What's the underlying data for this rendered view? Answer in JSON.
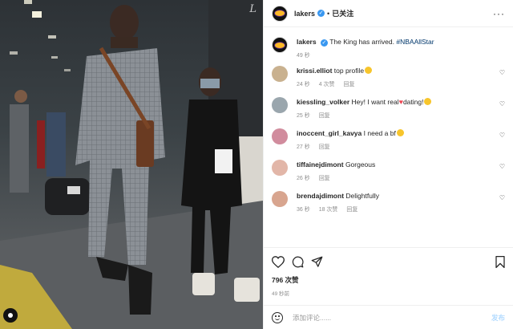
{
  "header": {
    "username": "lakers",
    "separator": "•",
    "follow_label": "已关注",
    "more_label": "···"
  },
  "caption": {
    "username": "lakers",
    "text": "The King has arrived.",
    "hashtag": "#NBAAllStar",
    "time": "49 秒"
  },
  "comments": [
    {
      "username": "krissi.elliot",
      "text": "top profile",
      "emoji": "smiley",
      "time": "24 秒",
      "likes": "4 次赞",
      "reply": "回复",
      "avatar_color": "#c9b18f"
    },
    {
      "username": "kiessling_volker",
      "text": "Hey! I want real",
      "text2": "dating!",
      "emoji": "heart+smiley",
      "time": "25 秒",
      "reply": "回复",
      "avatar_color": "#9aa6ad"
    },
    {
      "username": "inoccent_girl_kavya",
      "text": "I need a bf",
      "emoji": "smiley",
      "time": "27 秒",
      "reply": "回复",
      "avatar_color": "#d18c9d"
    },
    {
      "username": "tiffainejdimont",
      "text": "Gorgeous",
      "time": "26 秒",
      "reply": "回复",
      "avatar_color": "#e2b6a8"
    },
    {
      "username": "brendajdimont",
      "text": "Delightfully",
      "time": "36 秒",
      "likes": "18 次赞",
      "reply": "回复",
      "avatar_color": "#d8a58f"
    }
  ],
  "actions": {
    "icons": [
      "heart-icon",
      "comment-icon",
      "share-icon",
      "bookmark-icon"
    ],
    "likes": "796 次赞",
    "age": "49 秒前"
  },
  "add_comment": {
    "placeholder": "添加评论......",
    "post_label": "发布"
  },
  "colors": {
    "link": "#00376b",
    "verified": "#3897f0",
    "meta": "#8e8e8e",
    "post_disabled": "#b3dbff",
    "heart_emoji": "#ed4956"
  }
}
